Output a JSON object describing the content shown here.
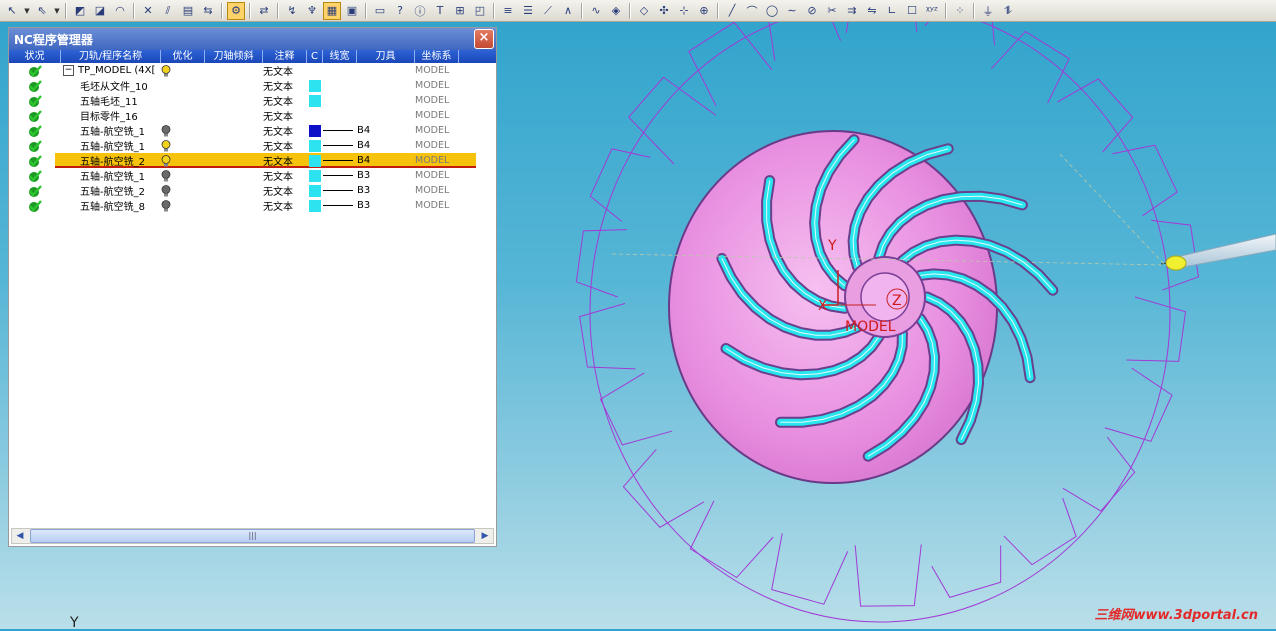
{
  "toolbar": {
    "icons": [
      "pointer",
      "select",
      "mill-surface",
      "mill-surface-2",
      "mill-curve",
      "mill-point",
      "tilt",
      "rule",
      "layer",
      "machine-sim",
      "transfer",
      "playback",
      "material-removal",
      "nc-manager",
      "window",
      "toolpath-view",
      "help",
      "info",
      "tool",
      "network",
      "block",
      "list",
      "list-2",
      "curve-edit",
      "profile",
      "spline",
      "shaded",
      "wireframe",
      "point-move",
      "axis-move",
      "axis-select",
      "line",
      "arc",
      "circle",
      "spline-2",
      "cut",
      "trim",
      "offset",
      "mirror",
      "corner",
      "box",
      "xyz-coord",
      "dots",
      "tool-probe",
      "mode"
    ]
  },
  "panel": {
    "title": "NC程序管理器",
    "close": "×",
    "columns": [
      "状况",
      "刀轨/程序名称",
      "优化",
      "刀轴倾斜",
      "注释",
      "C",
      "线宽",
      "刀具",
      "坐标系"
    ],
    "rows": [
      {
        "name": "TP_MODEL (4X[",
        "expand": "−",
        "opt": "yellow",
        "note": "无文本",
        "swatch": "",
        "width": false,
        "tool": "",
        "coord": "MODEL",
        "selected": false
      },
      {
        "name": "毛坯从文件_10",
        "expand": "",
        "opt": "",
        "note": "无文本",
        "swatch": "cyan",
        "width": false,
        "tool": "",
        "coord": "MODEL",
        "selected": false
      },
      {
        "name": "五轴毛坯_11",
        "expand": "",
        "opt": "",
        "note": "无文本",
        "swatch": "cyan",
        "width": false,
        "tool": "",
        "coord": "MODEL",
        "selected": false
      },
      {
        "name": "目标零件_16",
        "expand": "",
        "opt": "",
        "note": "无文本",
        "swatch": "",
        "width": false,
        "tool": "",
        "coord": "MODEL",
        "selected": false
      },
      {
        "name": "五轴-航空铣_1",
        "expand": "",
        "opt": "gray",
        "note": "无文本",
        "swatch": "blue",
        "width": true,
        "tool": "B4",
        "coord": "MODEL",
        "selected": false
      },
      {
        "name": "五轴-航空铣_1",
        "expand": "",
        "opt": "yellow",
        "note": "无文本",
        "swatch": "cyan",
        "width": true,
        "tool": "B4",
        "coord": "MODEL",
        "selected": false
      },
      {
        "name": "五轴-航空铣_2",
        "expand": "",
        "opt": "yellow",
        "note": "无文本",
        "swatch": "cyan",
        "width": true,
        "tool": "B4",
        "coord": "MODEL",
        "selected": true
      },
      {
        "name": "五轴-航空铣_1",
        "expand": "",
        "opt": "gray",
        "note": "无文本",
        "swatch": "cyan",
        "width": true,
        "tool": "B3",
        "coord": "MODEL",
        "selected": false
      },
      {
        "name": "五轴-航空铣_2",
        "expand": "",
        "opt": "gray",
        "note": "无文本",
        "swatch": "cyan",
        "width": true,
        "tool": "B3",
        "coord": "MODEL",
        "selected": false
      },
      {
        "name": "五轴-航空铣_8",
        "expand": "",
        "opt": "gray",
        "note": "无文本",
        "swatch": "cyan",
        "width": true,
        "tool": "B3",
        "coord": "MODEL",
        "selected": false
      }
    ],
    "scroll_thumb": "|||"
  },
  "viewport": {
    "axis_y": "Y",
    "axis_x": "X",
    "axis_z": "Z",
    "csys_label": "MODEL",
    "corner_axis": "Y",
    "watermark": "三维网www.3dportal.cn"
  },
  "colors": {
    "swatch_cyan": "#2de3f0",
    "swatch_blue": "#1010c8",
    "bulb_yellow": "#f3d21c",
    "bulb_gray": "#6a6a6a",
    "toolpath": "#27e6ee",
    "disk": "#f29be8",
    "blade_outline": "#a13ad6"
  }
}
